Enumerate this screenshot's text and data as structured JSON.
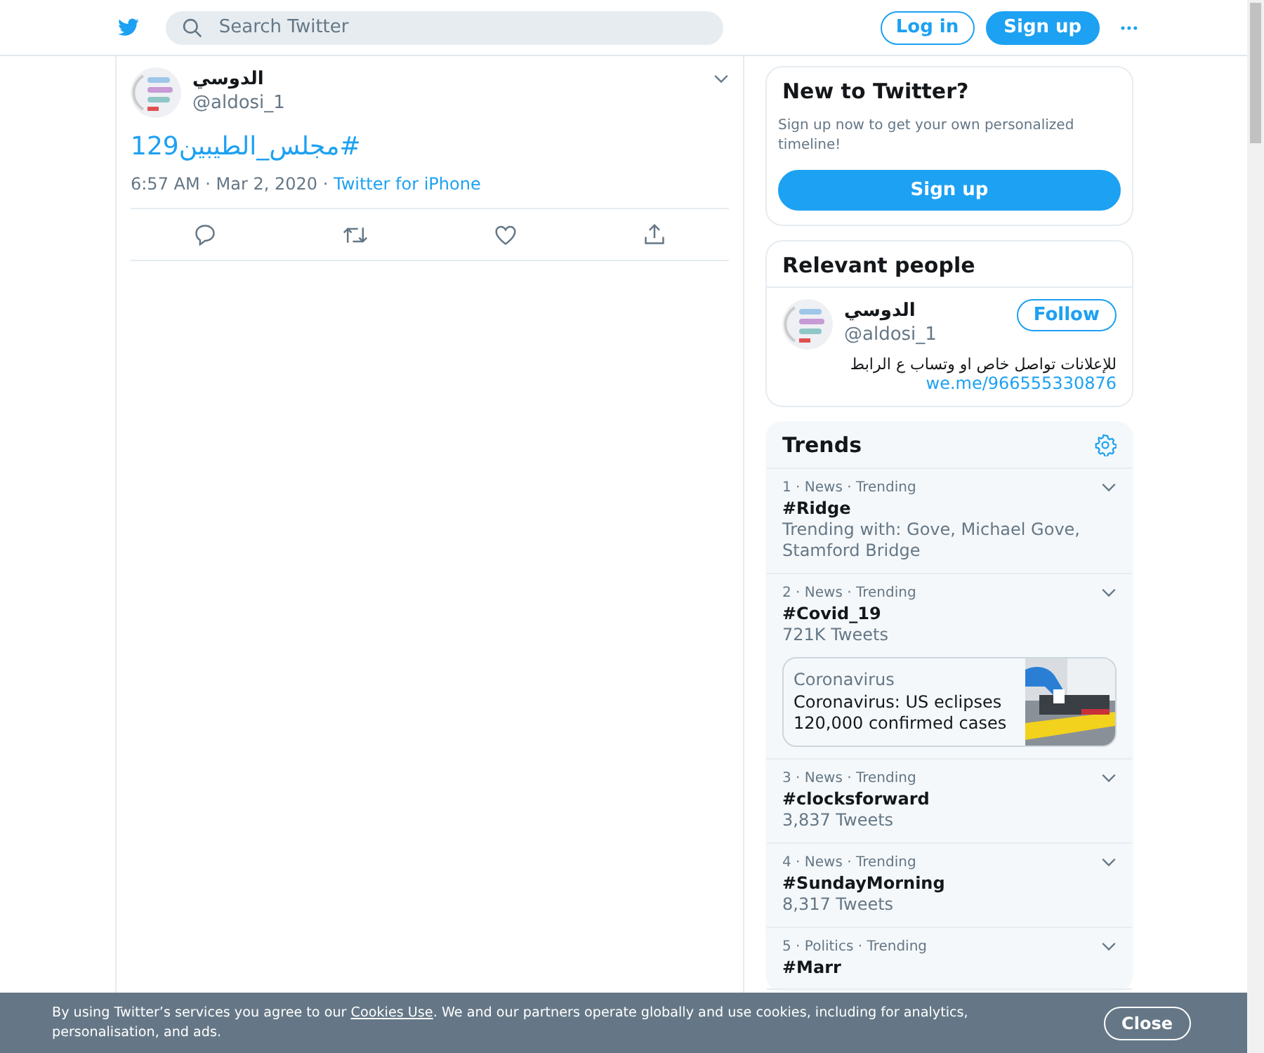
{
  "header": {
    "search": {
      "placeholder": "Search Twitter"
    },
    "login": "Log in",
    "signup": "Sign up"
  },
  "tweet": {
    "name": "الدوسي",
    "handle": "@aldosi_1",
    "text": "#مجلس_الطيبين129",
    "time": "6:57 AM · Mar 2, 2020 · ",
    "source": "Twitter for iPhone"
  },
  "signup_card": {
    "title": "New to Twitter?",
    "text": "Sign up now to get your own personalized timeline!",
    "button": "Sign up"
  },
  "relevant_people": {
    "title": "Relevant people",
    "people": [
      {
        "name": "الدوسي",
        "handle": "@aldosi_1",
        "follow": "Follow",
        "bio": "للإعلانات تواصل خاص او وتساب ع الرابط",
        "link": "we.me/966555330876"
      }
    ]
  },
  "trends": {
    "title": "Trends",
    "items": [
      {
        "meta": "1 · News · Trending",
        "tag": "#Ridge",
        "detail": "Trending with: Gove, Michael Gove, Stamford Bridge"
      },
      {
        "meta": "2 · News · Trending",
        "tag": "#Covid_19",
        "detail": "721K Tweets",
        "card": {
          "topic": "Coronavirus",
          "headline": "Coronavirus: US eclipses 120,000 confirmed cases"
        }
      },
      {
        "meta": "3 · News · Trending",
        "tag": "#clocksforward",
        "detail": "3,837 Tweets"
      },
      {
        "meta": "4 · News · Trending",
        "tag": "#SundayMorning",
        "detail": "8,317 Tweets"
      },
      {
        "meta": "5 · Politics · Trending",
        "tag": "#Marr"
      }
    ]
  },
  "cookie_banner": {
    "before": "By using Twitter’s services you agree to our ",
    "link": "Cookies Use",
    "after": ". We and our partners operate globally and use cookies, including for analytics, personalisation, and ads.",
    "close": "Close"
  }
}
